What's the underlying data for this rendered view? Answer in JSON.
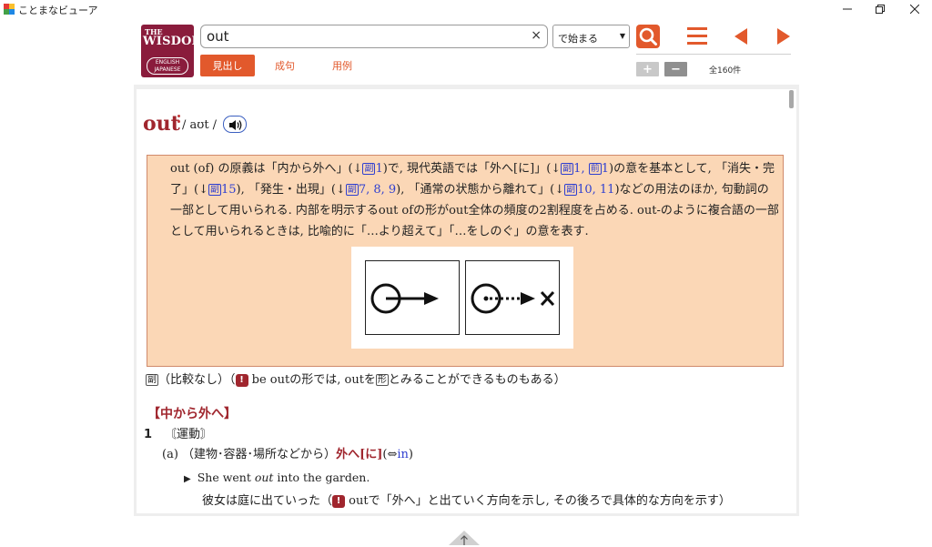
{
  "window": {
    "title": "ことまなビューア",
    "icon_colors": [
      "#e53935",
      "#fbc02d",
      "#43a047",
      "#1e88e5"
    ],
    "minimize_icon": "minimize-icon",
    "restore_icon": "restore-icon",
    "close_icon": "close-icon"
  },
  "logo": {
    "line1": "THE",
    "line2": "WISDOM",
    "line3": "ENGLISH",
    "line4": "JAPANESE"
  },
  "search": {
    "value": "out",
    "clear_icon": "×",
    "mode": "で始まる"
  },
  "tabs": [
    {
      "label": "見出し",
      "active": true
    },
    {
      "label": "成句",
      "active": false
    },
    {
      "label": "用例",
      "active": false
    }
  ],
  "zoom": {
    "plus": "+",
    "minus": "−"
  },
  "result_count": "全160件",
  "colors": {
    "accent": "#e2592c",
    "headword": "#a0262e",
    "note_bg": "#fbd7b6",
    "link": "#2f3fd0"
  },
  "entry": {
    "headword": "out",
    "pron": "/ aʊt /",
    "note": {
      "p1": "out (of) の原義は「内から外へ」(↓",
      "r1": "副",
      "r1n": "1",
      "p2": ")で, 現代英語では「外へ[に]」(↓",
      "r2": "副",
      "r2n": "1,",
      "r3": "前",
      "r3n": "1",
      "p3": ")の意を基本として, 「消失・完了」(↓",
      "r4": "副",
      "r4n": "15",
      "p4": "), 「発生・出現」(↓",
      "r5": "副",
      "r5n": "7, 8, 9",
      "p5": "), 「通常の状態から離れて」(↓",
      "r6": "副",
      "r6n": "10, 11",
      "p6": ")などの用法のほか, 句動詞の一部として用いられる. 内部を明示するout ofの形がout全体の頻度の2割程度を占める. out-のように複合語の一部として用いられるときは, 比喩的に「…より超えて」「…をしのぐ」の意を表す."
    },
    "pos": {
      "icon": "副",
      "text1": "（比較なし）（",
      "note_badge": "!",
      "text2": "be outの形では, outを",
      "kind_badge": "形",
      "text3": "とみることができるものもある）"
    },
    "section": "【中から外へ】",
    "sense": {
      "num": "1",
      "label": "〘運動〙"
    },
    "subsense": {
      "letter": "(a)",
      "ctx": "（建物･容器･場所などから）",
      "kw": "外へ",
      "kw2": "[に]",
      "rel_open": "(⇔",
      "rel": "in",
      "rel_close": ")"
    },
    "example": {
      "marker": "▶",
      "en_pre": "She went ",
      "en_key": "out",
      "en_post": " into the garden.",
      "ja_pre": "彼女は庭に出ていった（",
      "badge": "!",
      "ja_post": "outで「外へ」と出ていく方向を示し, その後ろで具体的な方向を示す）"
    }
  }
}
